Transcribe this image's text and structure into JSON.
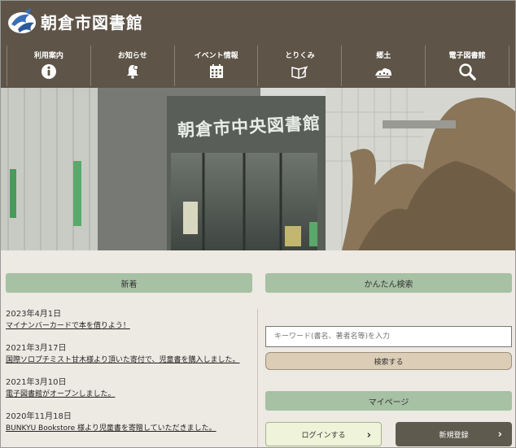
{
  "header": {
    "site_title": "朝倉市図書館",
    "colors": {
      "header_bg": "#5e5447",
      "section_bar": "#a6c1a3"
    }
  },
  "nav": [
    {
      "label": "利用案内",
      "icon": "info-icon"
    },
    {
      "label": "お知らせ",
      "icon": "bell-icon"
    },
    {
      "label": "イベント情報",
      "icon": "calendar-icon"
    },
    {
      "label": "とりくみ",
      "icon": "book-pen-icon"
    },
    {
      "label": "郷土",
      "icon": "landscape-icon"
    },
    {
      "label": "電子図書館",
      "icon": "search-icon"
    }
  ],
  "hero": {
    "sign_text": "朝倉市中央図書館"
  },
  "news": {
    "title": "新着",
    "items": [
      {
        "date": "2023年4月1日",
        "text": "マイナンバーカードで本を借りよう！"
      },
      {
        "date": "2021年3月17日",
        "text": "国際ソロプチミスト甘木様より頂いた寄付で、児童書を購入しました。"
      },
      {
        "date": "2021年3月10日",
        "text": "電子図書館がオープンしました。"
      },
      {
        "date": "2020年11月18日",
        "text": "BUNKYU Bookstore 様より児童書を寄贈していただきました。"
      }
    ]
  },
  "search": {
    "title": "かんたん検索",
    "placeholder": "キーワード(書名、著者名等)を入力",
    "button": "検索する"
  },
  "mypage": {
    "title": "マイページ",
    "login": "ログインする",
    "register": "新規登録"
  }
}
